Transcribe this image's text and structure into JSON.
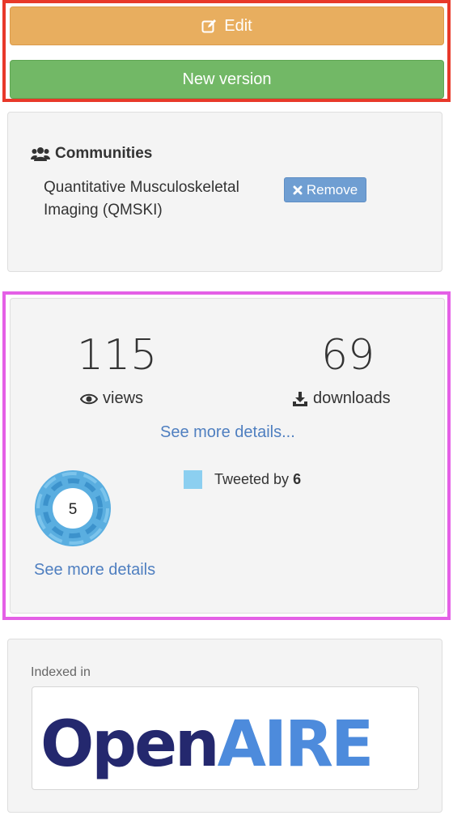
{
  "actions": {
    "edit_label": "Edit",
    "new_version_label": "New version"
  },
  "communities": {
    "title": "Communities",
    "name": "Quantitative Musculoskeletal Imaging (QMSKI)",
    "remove_label": "Remove"
  },
  "stats": {
    "views_count": "115",
    "views_label": "views",
    "downloads_count": "69",
    "downloads_label": "downloads",
    "details_link": "See more details...",
    "altmetric_score": "5",
    "tweeted_prefix": "Tweeted by",
    "tweeted_count": "6",
    "altmetric_details_link": "See more details"
  },
  "indexed": {
    "label": "Indexed in",
    "logo_open": "Open",
    "logo_aire": "AIRE"
  },
  "colors": {
    "edit_button": "#e8ae5f",
    "new_version_button": "#72b866",
    "remove_button": "#6f9ed2",
    "link": "#4f7fc0",
    "tweet_legend": "#8ccff0",
    "openaire_dark": "#24286e",
    "openaire_light": "#4d8bdc"
  },
  "icons": {
    "edit": "edit-icon",
    "communities": "users-icon",
    "remove": "close-icon",
    "views": "eye-icon",
    "downloads": "download-icon"
  }
}
